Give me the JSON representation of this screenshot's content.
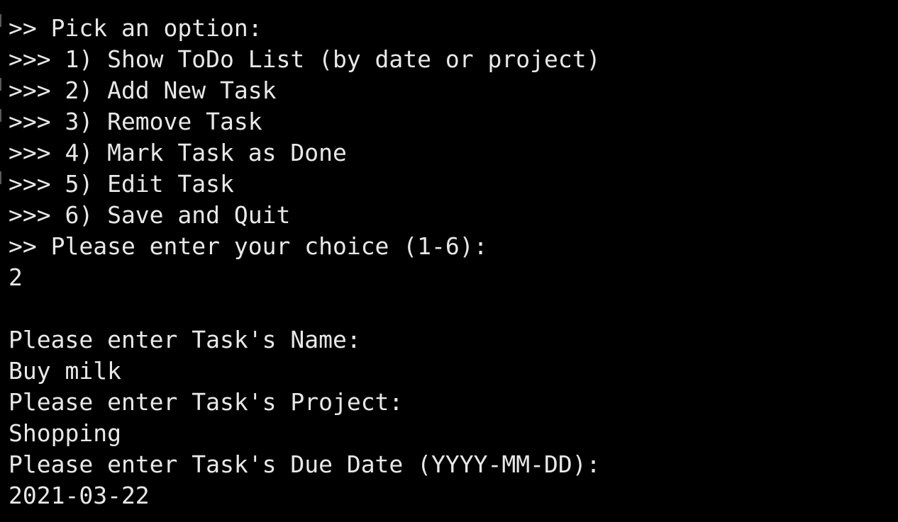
{
  "terminal": {
    "lines": [
      {
        "text": ">> Pick an option:",
        "kind": "prompt"
      },
      {
        "text": ">>> 1) Show ToDo List (by date or project)",
        "kind": "menu-item"
      },
      {
        "text": ">>> 2) Add New Task",
        "kind": "menu-item"
      },
      {
        "text": ">>> 3) Remove Task",
        "kind": "menu-item"
      },
      {
        "text": ">>> 4) Mark Task as Done",
        "kind": "menu-item"
      },
      {
        "text": ">>> 5) Edit Task",
        "kind": "menu-item"
      },
      {
        "text": ">>> 6) Save and Quit",
        "kind": "menu-item"
      },
      {
        "text": ">> Please enter your choice (1-6):",
        "kind": "prompt"
      },
      {
        "text": "2",
        "kind": "input"
      },
      {
        "text": "",
        "kind": "blank"
      },
      {
        "text": "Please enter Task's Name:",
        "kind": "prompt"
      },
      {
        "text": "Buy milk",
        "kind": "input"
      },
      {
        "text": "Please enter Task's Project:",
        "kind": "prompt"
      },
      {
        "text": "Shopping",
        "kind": "input"
      },
      {
        "text": "Please enter Task's Due Date (YYYY-MM-DD):",
        "kind": "prompt"
      },
      {
        "text": "2021-03-22",
        "kind": "input"
      }
    ]
  },
  "colors": {
    "background": "#000000",
    "foreground": "#e8e8e8"
  }
}
